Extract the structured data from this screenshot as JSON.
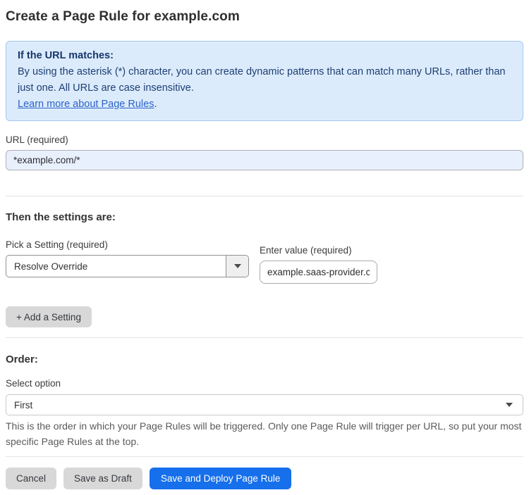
{
  "page": {
    "title": "Create a Page Rule for example.com"
  },
  "info_box": {
    "heading": "If the URL matches:",
    "body": "By using the asterisk (*) character, you can create dynamic patterns that can match many URLs, rather than just one. All URLs are case insensitive.",
    "link": "Learn more about Page Rules",
    "link_suffix": "."
  },
  "url_field": {
    "label": "URL (required)",
    "value": "*example.com/*"
  },
  "settings": {
    "heading": "Then the settings are:",
    "setting_label": "Pick a Setting (required)",
    "setting_value": "Resolve Override",
    "value_label": "Enter value (required)",
    "value_value": "example.saas-provider.c",
    "add_button": "+ Add a Setting"
  },
  "order": {
    "heading": "Order:",
    "select_label": "Select option",
    "select_value": "First",
    "help_text": "This is the order in which your Page Rules will be triggered. Only one Page Rule will trigger per URL, so put your most specific Page Rules at the top."
  },
  "actions": {
    "cancel": "Cancel",
    "save_draft": "Save as Draft",
    "save_deploy": "Save and Deploy Page Rule"
  },
  "colors": {
    "accent_blue": "#166feb",
    "info_box_bg": "#dcebfc",
    "info_box_border": "#a6c8f0",
    "info_text": "#1d3f72",
    "link_blue": "#2c63c9",
    "autofill_input_bg": "#e8f0fe",
    "gray_button_bg": "#d8d8d8"
  }
}
